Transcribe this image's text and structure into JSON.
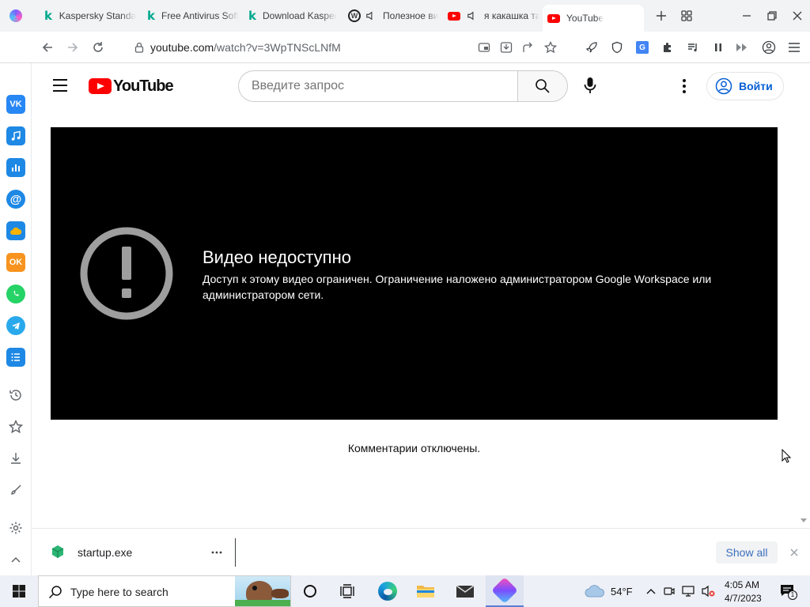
{
  "tabs": [
    {
      "title": "Kaspersky Standard",
      "icon": "kaspersky-icon"
    },
    {
      "title": "Free Antivirus Software",
      "icon": "kaspersky-icon"
    },
    {
      "title": "Download Kaspersky",
      "icon": "kaspersky-icon"
    },
    {
      "title": "Полезное видео",
      "icon": "w-site-icon"
    },
    {
      "title": "я какашка та",
      "icon": "youtube-icon"
    },
    {
      "title": "YouTube",
      "icon": "youtube-icon"
    }
  ],
  "address": {
    "host": "youtube.com",
    "path": "/watch?v=3WpTNScLNfM"
  },
  "youtube": {
    "logo_text": "YouTube",
    "search_placeholder": "Введите запрос",
    "signin_label": "Войти",
    "error_title": "Видео недоступно",
    "error_message": "Доступ к этому видео ограничен. Ограничение наложено администратором Google Workspace или администратором сети.",
    "comments_disabled": "Комментарии отключены."
  },
  "download_bar": {
    "file_name": "startup.exe",
    "show_all_label": "Show all"
  },
  "taskbar": {
    "search_placeholder": "Type here to search",
    "weather_temp": "54°F",
    "time": "4:05 AM",
    "date": "4/7/2023",
    "notification_count": "1"
  },
  "colors": {
    "youtube_red": "#ff0000",
    "accent_blue": "#065fd4",
    "player_bg": "#000000",
    "kaspersky_green": "#00a88e"
  }
}
